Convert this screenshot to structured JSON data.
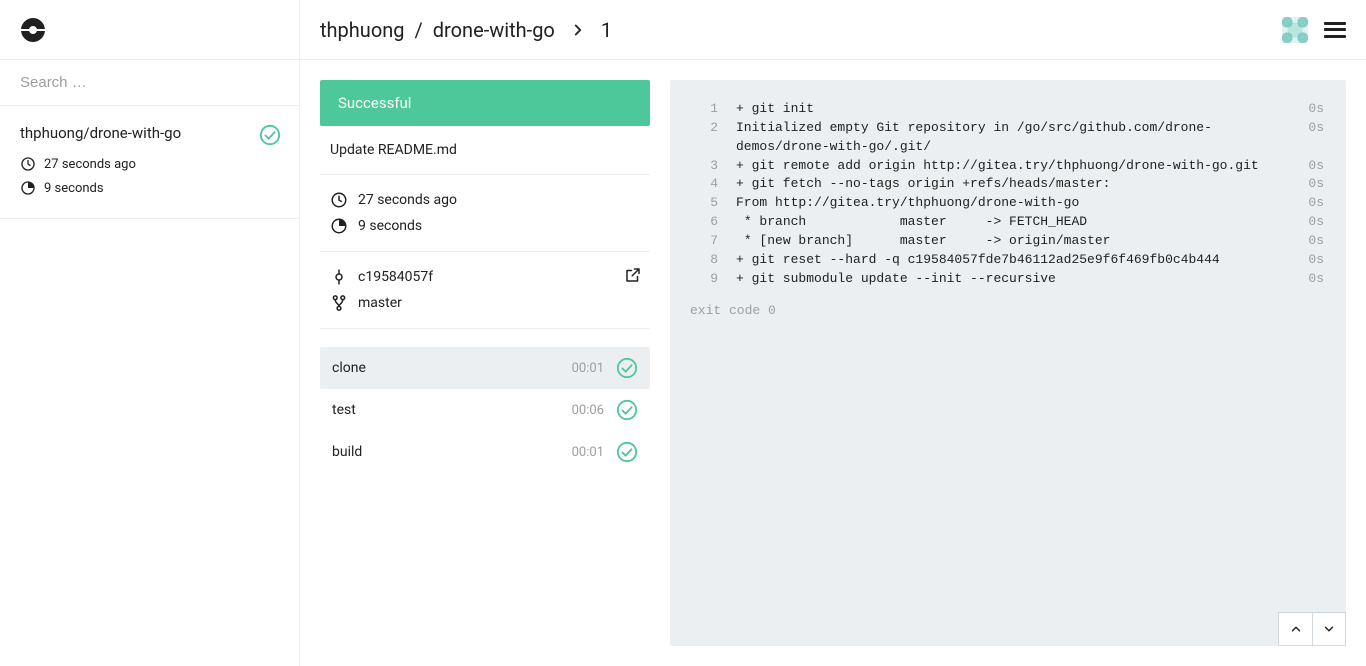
{
  "colors": {
    "accent": "#4dc89a",
    "muted": "#9e9e9e",
    "panel": "#eceff1"
  },
  "search": {
    "placeholder": "Search …"
  },
  "sidebar": {
    "repo": {
      "name": "thphuong/drone-with-go",
      "started": "27 seconds ago",
      "duration": "9 seconds"
    }
  },
  "header": {
    "owner": "thphuong",
    "repo": "drone-with-go",
    "build_number": "1"
  },
  "build": {
    "status_label": "Successful",
    "commit_message": "Update README.md",
    "started": "27 seconds ago",
    "duration": "9 seconds",
    "commit_sha": "c19584057f",
    "branch": "master"
  },
  "steps": [
    {
      "name": "clone",
      "time": "00:01",
      "active": true
    },
    {
      "name": "test",
      "time": "00:06",
      "active": false
    },
    {
      "name": "build",
      "time": "00:01",
      "active": false
    }
  ],
  "log": {
    "lines": [
      {
        "n": "1",
        "text": "+ git init",
        "dur": "0s"
      },
      {
        "n": "2",
        "text": "Initialized empty Git repository in /go/src/github.com/drone-demos/drone-with-go/.git/",
        "dur": "0s"
      },
      {
        "n": "3",
        "text": "+ git remote add origin http://gitea.try/thphuong/drone-with-go.git",
        "dur": "0s"
      },
      {
        "n": "4",
        "text": "+ git fetch --no-tags origin +refs/heads/master:",
        "dur": "0s"
      },
      {
        "n": "5",
        "text": "From http://gitea.try/thphuong/drone-with-go",
        "dur": "0s"
      },
      {
        "n": "6",
        "text": " * branch            master     -> FETCH_HEAD",
        "dur": "0s"
      },
      {
        "n": "7",
        "text": " * [new branch]      master     -> origin/master",
        "dur": "0s"
      },
      {
        "n": "8",
        "text": "+ git reset --hard -q c19584057fde7b46112ad25e9f6f469fb0c4b444",
        "dur": "0s"
      },
      {
        "n": "9",
        "text": "+ git submodule update --init --recursive",
        "dur": "0s"
      }
    ],
    "exit_code_label": "exit code 0"
  }
}
